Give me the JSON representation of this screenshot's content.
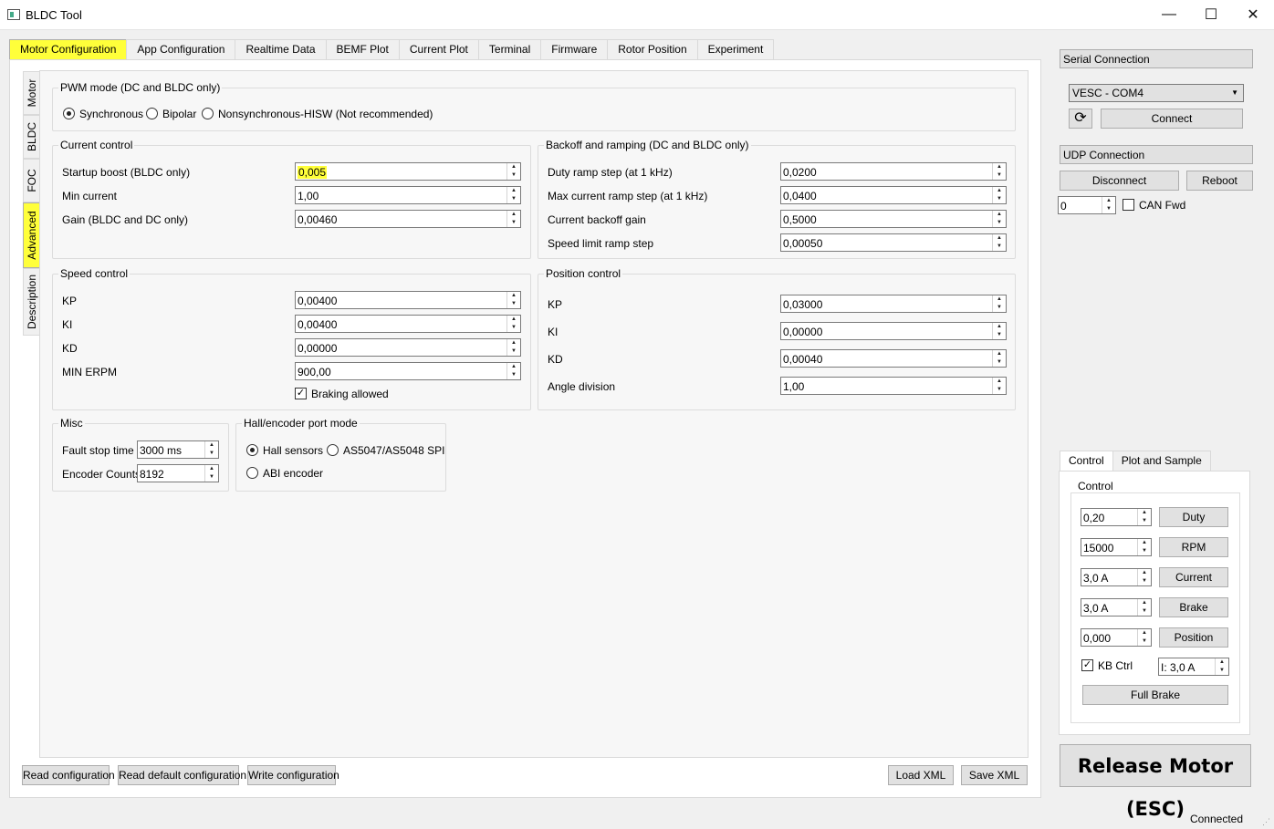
{
  "window": {
    "title": "BLDC Tool",
    "minimize": "—",
    "maximize": "☐",
    "close": "✕"
  },
  "main_tabs": [
    "Motor Configuration",
    "App Configuration",
    "Realtime Data",
    "BEMF Plot",
    "Current Plot",
    "Terminal",
    "Firmware",
    "Rotor Position",
    "Experiment"
  ],
  "side_tabs": [
    "Motor",
    "BLDC",
    "FOC",
    "Advanced",
    "Description"
  ],
  "pwm": {
    "title": "PWM mode (DC and BLDC only)",
    "options": [
      "Synchronous",
      "Bipolar",
      "Nonsynchronous-HISW (Not recommended)"
    ],
    "selected": "Synchronous"
  },
  "current_control": {
    "title": "Current control",
    "rows": [
      {
        "label": "Startup boost (BLDC only)",
        "value": "0,005"
      },
      {
        "label": "Min current",
        "value": "1,00"
      },
      {
        "label": "Gain (BLDC and DC only)",
        "value": "0,00460"
      }
    ]
  },
  "backoff": {
    "title": "Backoff and ramping (DC and BLDC only)",
    "rows": [
      {
        "label": "Duty ramp step (at 1 kHz)",
        "value": "0,0200"
      },
      {
        "label": "Max current ramp step (at 1 kHz)",
        "value": "0,0400"
      },
      {
        "label": "Current backoff gain",
        "value": "0,5000"
      },
      {
        "label": "Speed limit ramp step",
        "value": "0,00050"
      }
    ]
  },
  "speed_control": {
    "title": "Speed control",
    "rows": [
      {
        "label": "KP",
        "value": "0,00400"
      },
      {
        "label": "KI",
        "value": "0,00400"
      },
      {
        "label": "KD",
        "value": "0,00000"
      },
      {
        "label": "MIN ERPM",
        "value": "900,00"
      }
    ],
    "braking_label": "Braking allowed",
    "braking": true
  },
  "position_control": {
    "title": "Position control",
    "rows": [
      {
        "label": "KP",
        "value": "0,03000"
      },
      {
        "label": "KI",
        "value": "0,00000"
      },
      {
        "label": "KD",
        "value": "0,00040"
      },
      {
        "label": "Angle division",
        "value": "1,00"
      }
    ]
  },
  "misc": {
    "title": "Misc",
    "fault_label": "Fault stop time",
    "fault_value": "3000 ms",
    "enc_label": "Encoder Counts",
    "enc_value": "8192"
  },
  "hall": {
    "title": "Hall/encoder port mode",
    "options": [
      "Hall sensors",
      "AS5047/AS5048 SPI",
      "ABI encoder"
    ],
    "selected": "Hall sensors"
  },
  "bottom_buttons": {
    "read": "Read configuration",
    "read_default": "Read default configuration",
    "write": "Write configuration",
    "load_xml": "Load XML",
    "save_xml": "Save XML"
  },
  "serial": {
    "title": "Serial Connection",
    "port": "VESC - COM4",
    "connect": "Connect",
    "refresh_icon": "refresh-icon"
  },
  "udp": {
    "title": "UDP Connection",
    "disconnect": "Disconnect",
    "reboot": "Reboot",
    "can_id": "0",
    "can_fwd": "CAN Fwd"
  },
  "control_tabs": [
    "Control",
    "Plot and Sample"
  ],
  "control": {
    "title": "Control",
    "rows": [
      {
        "value": "0,20",
        "button": "Duty"
      },
      {
        "value": "15000",
        "button": "RPM"
      },
      {
        "value": "3,0 A",
        "button": "Current"
      },
      {
        "value": "3,0 A",
        "button": "Brake"
      },
      {
        "value": "0,000",
        "button": "Position"
      }
    ],
    "kb_label": "KB Ctrl",
    "kb_checked": true,
    "kb_current": "I: 3,0 A",
    "full_brake": "Full Brake"
  },
  "release": "Release Motor (ESC)",
  "status": "Connected",
  "colors": {
    "highlight": "#ffff3a",
    "panel": "#ffffff",
    "chrome": "#f0f0f0"
  }
}
